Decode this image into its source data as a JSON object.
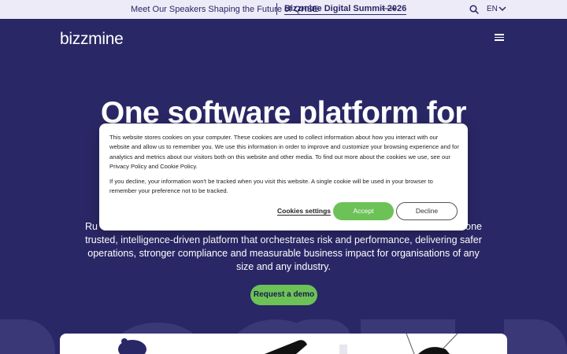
{
  "topbar": {
    "promo_text": "Meet Our Speakers Shaping the Future of QHSE",
    "link_text": "Bizzmine Digital Summit 2026",
    "arrow": "⟶",
    "language": "EN"
  },
  "header": {
    "logo": "bizzmine"
  },
  "hero": {
    "headline": "One software platform for",
    "body_line1": "Ru",
    "body_line1_tail": "one",
    "body_rest": "trusted, intelligence-driven platform that orchestrates risk and performance, delivering safer operations, stronger compliance and measurable business impact for organisations of any size and any industry.",
    "cta_label": "Request a demo"
  },
  "cookie_banner": {
    "paragraph1": "This website stores cookies on your computer. These cookies are used to collect information about how you interact with our website and allow us to remember you. We use this information in order to improve and customize your browsing experience and for analytics and metrics about our visitors both on this website and other media. To find out more about the cookies we use, see our Privacy Policy and Cookie Policy.",
    "paragraph2": "If you decline, your information won't be tracked when you visit this website. A single cookie will be used in your browser to remember your preference not to be tracked.",
    "settings_label": "Cookies settings",
    "accept_label": "Accept",
    "decline_label": "Decline"
  },
  "colors": {
    "brand_navy": "#2a2766",
    "accent_green": "#6cc257",
    "topbar_bg": "#ecebf7"
  },
  "icons": {
    "search": "search-icon",
    "chevron": "chevron-down-icon",
    "menu": "hamburger-menu-icon"
  }
}
